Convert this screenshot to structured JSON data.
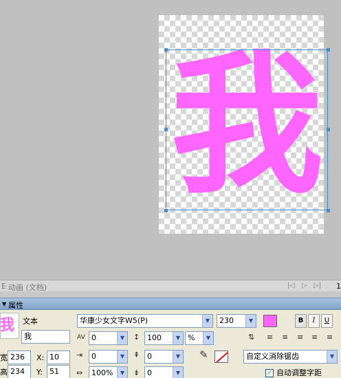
{
  "canvas": {
    "glyph": "我",
    "glyph_color": "#ff66ff",
    "selection_color": "#3c8fd8"
  },
  "timeline": {
    "title": "动画 (文档)",
    "prefix": "E",
    "frame_number": "1"
  },
  "properties": {
    "header": "属性",
    "thumbnail_text": "我",
    "object_type": "文本",
    "object_name": "我",
    "width_label": "宽:",
    "width_value": "236",
    "height_label": "高:",
    "height_value": "234",
    "x_label": "X:",
    "x_value": "10",
    "y_label": "Y:",
    "y_value": "51",
    "font_family": "华康少女文字W5(P)",
    "font_size": "230",
    "fill_color": "#ff66ff",
    "bold_label": "B",
    "italic_label": "I",
    "underline_label": "U",
    "kerning_value": "0",
    "leading_value": "100",
    "leading_unit": "%",
    "indent_value": "0",
    "space_before_value": "0",
    "horizontal_scale_value": "100%",
    "space_after_value": "0",
    "antialias_value": "自定义消除锯齿",
    "auto_kern_label": "自动调整字距",
    "auto_kern_checked": "✓",
    "stroke_color": "#ffffff"
  },
  "icons": {
    "play": "▷",
    "rewind": "|◁",
    "forward": "▷|",
    "pencil": "✎",
    "dropdown": "▼"
  }
}
